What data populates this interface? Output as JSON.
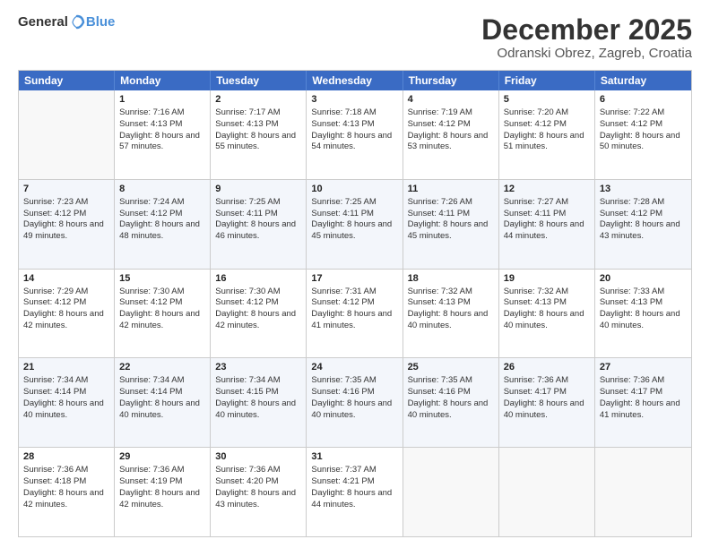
{
  "header": {
    "logo_general": "General",
    "logo_blue": "Blue",
    "month": "December 2025",
    "location": "Odranski Obrez, Zagreb, Croatia"
  },
  "weekdays": [
    "Sunday",
    "Monday",
    "Tuesday",
    "Wednesday",
    "Thursday",
    "Friday",
    "Saturday"
  ],
  "rows": [
    [
      {
        "day": "",
        "sunrise": "",
        "sunset": "",
        "daylight": "",
        "empty": true
      },
      {
        "day": "1",
        "sunrise": "Sunrise: 7:16 AM",
        "sunset": "Sunset: 4:13 PM",
        "daylight": "Daylight: 8 hours and 57 minutes."
      },
      {
        "day": "2",
        "sunrise": "Sunrise: 7:17 AM",
        "sunset": "Sunset: 4:13 PM",
        "daylight": "Daylight: 8 hours and 55 minutes."
      },
      {
        "day": "3",
        "sunrise": "Sunrise: 7:18 AM",
        "sunset": "Sunset: 4:13 PM",
        "daylight": "Daylight: 8 hours and 54 minutes."
      },
      {
        "day": "4",
        "sunrise": "Sunrise: 7:19 AM",
        "sunset": "Sunset: 4:12 PM",
        "daylight": "Daylight: 8 hours and 53 minutes."
      },
      {
        "day": "5",
        "sunrise": "Sunrise: 7:20 AM",
        "sunset": "Sunset: 4:12 PM",
        "daylight": "Daylight: 8 hours and 51 minutes."
      },
      {
        "day": "6",
        "sunrise": "Sunrise: 7:22 AM",
        "sunset": "Sunset: 4:12 PM",
        "daylight": "Daylight: 8 hours and 50 minutes."
      }
    ],
    [
      {
        "day": "7",
        "sunrise": "Sunrise: 7:23 AM",
        "sunset": "Sunset: 4:12 PM",
        "daylight": "Daylight: 8 hours and 49 minutes."
      },
      {
        "day": "8",
        "sunrise": "Sunrise: 7:24 AM",
        "sunset": "Sunset: 4:12 PM",
        "daylight": "Daylight: 8 hours and 48 minutes."
      },
      {
        "day": "9",
        "sunrise": "Sunrise: 7:25 AM",
        "sunset": "Sunset: 4:11 PM",
        "daylight": "Daylight: 8 hours and 46 minutes."
      },
      {
        "day": "10",
        "sunrise": "Sunrise: 7:25 AM",
        "sunset": "Sunset: 4:11 PM",
        "daylight": "Daylight: 8 hours and 45 minutes."
      },
      {
        "day": "11",
        "sunrise": "Sunrise: 7:26 AM",
        "sunset": "Sunset: 4:11 PM",
        "daylight": "Daylight: 8 hours and 45 minutes."
      },
      {
        "day": "12",
        "sunrise": "Sunrise: 7:27 AM",
        "sunset": "Sunset: 4:11 PM",
        "daylight": "Daylight: 8 hours and 44 minutes."
      },
      {
        "day": "13",
        "sunrise": "Sunrise: 7:28 AM",
        "sunset": "Sunset: 4:12 PM",
        "daylight": "Daylight: 8 hours and 43 minutes."
      }
    ],
    [
      {
        "day": "14",
        "sunrise": "Sunrise: 7:29 AM",
        "sunset": "Sunset: 4:12 PM",
        "daylight": "Daylight: 8 hours and 42 minutes."
      },
      {
        "day": "15",
        "sunrise": "Sunrise: 7:30 AM",
        "sunset": "Sunset: 4:12 PM",
        "daylight": "Daylight: 8 hours and 42 minutes."
      },
      {
        "day": "16",
        "sunrise": "Sunrise: 7:30 AM",
        "sunset": "Sunset: 4:12 PM",
        "daylight": "Daylight: 8 hours and 42 minutes."
      },
      {
        "day": "17",
        "sunrise": "Sunrise: 7:31 AM",
        "sunset": "Sunset: 4:12 PM",
        "daylight": "Daylight: 8 hours and 41 minutes."
      },
      {
        "day": "18",
        "sunrise": "Sunrise: 7:32 AM",
        "sunset": "Sunset: 4:13 PM",
        "daylight": "Daylight: 8 hours and 40 minutes."
      },
      {
        "day": "19",
        "sunrise": "Sunrise: 7:32 AM",
        "sunset": "Sunset: 4:13 PM",
        "daylight": "Daylight: 8 hours and 40 minutes."
      },
      {
        "day": "20",
        "sunrise": "Sunrise: 7:33 AM",
        "sunset": "Sunset: 4:13 PM",
        "daylight": "Daylight: 8 hours and 40 minutes."
      }
    ],
    [
      {
        "day": "21",
        "sunrise": "Sunrise: 7:34 AM",
        "sunset": "Sunset: 4:14 PM",
        "daylight": "Daylight: 8 hours and 40 minutes."
      },
      {
        "day": "22",
        "sunrise": "Sunrise: 7:34 AM",
        "sunset": "Sunset: 4:14 PM",
        "daylight": "Daylight: 8 hours and 40 minutes."
      },
      {
        "day": "23",
        "sunrise": "Sunrise: 7:34 AM",
        "sunset": "Sunset: 4:15 PM",
        "daylight": "Daylight: 8 hours and 40 minutes."
      },
      {
        "day": "24",
        "sunrise": "Sunrise: 7:35 AM",
        "sunset": "Sunset: 4:16 PM",
        "daylight": "Daylight: 8 hours and 40 minutes."
      },
      {
        "day": "25",
        "sunrise": "Sunrise: 7:35 AM",
        "sunset": "Sunset: 4:16 PM",
        "daylight": "Daylight: 8 hours and 40 minutes."
      },
      {
        "day": "26",
        "sunrise": "Sunrise: 7:36 AM",
        "sunset": "Sunset: 4:17 PM",
        "daylight": "Daylight: 8 hours and 40 minutes."
      },
      {
        "day": "27",
        "sunrise": "Sunrise: 7:36 AM",
        "sunset": "Sunset: 4:17 PM",
        "daylight": "Daylight: 8 hours and 41 minutes."
      }
    ],
    [
      {
        "day": "28",
        "sunrise": "Sunrise: 7:36 AM",
        "sunset": "Sunset: 4:18 PM",
        "daylight": "Daylight: 8 hours and 42 minutes."
      },
      {
        "day": "29",
        "sunrise": "Sunrise: 7:36 AM",
        "sunset": "Sunset: 4:19 PM",
        "daylight": "Daylight: 8 hours and 42 minutes."
      },
      {
        "day": "30",
        "sunrise": "Sunrise: 7:36 AM",
        "sunset": "Sunset: 4:20 PM",
        "daylight": "Daylight: 8 hours and 43 minutes."
      },
      {
        "day": "31",
        "sunrise": "Sunrise: 7:37 AM",
        "sunset": "Sunset: 4:21 PM",
        "daylight": "Daylight: 8 hours and 44 minutes."
      },
      {
        "day": "",
        "sunrise": "",
        "sunset": "",
        "daylight": "",
        "empty": true
      },
      {
        "day": "",
        "sunrise": "",
        "sunset": "",
        "daylight": "",
        "empty": true
      },
      {
        "day": "",
        "sunrise": "",
        "sunset": "",
        "daylight": "",
        "empty": true
      }
    ]
  ]
}
